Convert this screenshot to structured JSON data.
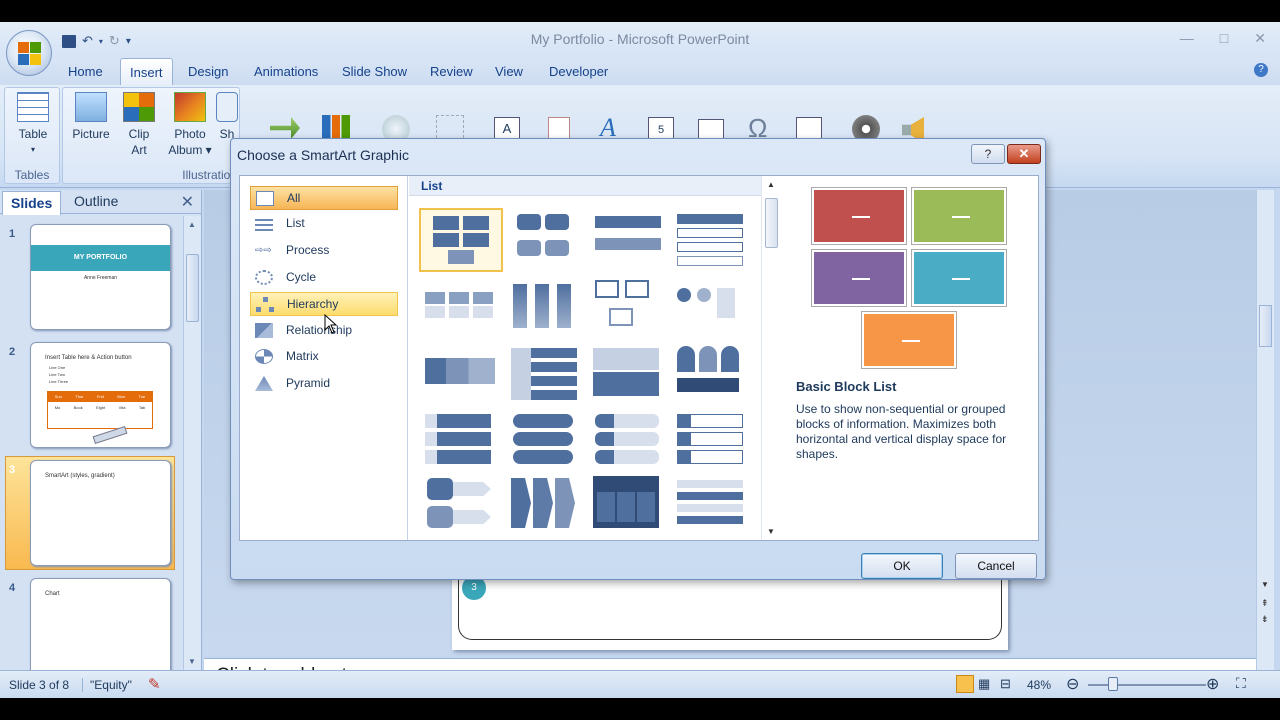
{
  "window": {
    "title": "My Portfolio - Microsoft PowerPoint",
    "controls": [
      "—",
      "□",
      "✕"
    ]
  },
  "tabs": [
    {
      "label": "Home",
      "active": false
    },
    {
      "label": "Insert",
      "active": true
    },
    {
      "label": "Design",
      "active": false
    },
    {
      "label": "Animations",
      "active": false
    },
    {
      "label": "Slide Show",
      "active": false
    },
    {
      "label": "Review",
      "active": false
    },
    {
      "label": "View",
      "active": false
    },
    {
      "label": "Developer",
      "active": false
    }
  ],
  "ribbon": {
    "groups": {
      "tables": "Tables",
      "illustrations": "Illustration"
    },
    "buttons": {
      "table": "Table",
      "table_arrow": "▾",
      "picture": "Picture",
      "clip_art_1": "Clip",
      "clip_art_2": "Art",
      "photo_album_1": "Photo",
      "photo_album_2": "Album ▾",
      "shapes": "Sh"
    }
  },
  "left_pane": {
    "tab_slides": "Slides",
    "tab_outline": "Outline",
    "close": "✕",
    "slides": [
      {
        "num": "1",
        "title": "MY PORTFOLIO",
        "subtitle": "Anne Freeman"
      },
      {
        "num": "2",
        "title": "Insert Table here & Action button",
        "bullets": [
          "Line One",
          "Line Two",
          "Line Three"
        ],
        "table_headers": [
          "Sun",
          "Thur",
          "Frid",
          "Mon",
          "Tue"
        ],
        "table_row": [
          "Mo",
          "Book",
          "Eight",
          "Vita",
          "Tab"
        ]
      },
      {
        "num": "3",
        "title": "SmartArt (styles, gradient)",
        "selected": true
      },
      {
        "num": "4",
        "title": "Chart"
      }
    ]
  },
  "canvas": {
    "circle_num": "3"
  },
  "notes": {
    "placeholder": "Click to add notes"
  },
  "status": {
    "slide": "Slide 3 of 8",
    "theme": "\"Equity\"",
    "zoom": "48%"
  },
  "dialog": {
    "title": "Choose a SmartArt Graphic",
    "help": "?",
    "close": "✕",
    "categories": [
      {
        "label": "All",
        "state": "selected"
      },
      {
        "label": "List",
        "state": "normal"
      },
      {
        "label": "Process",
        "state": "normal"
      },
      {
        "label": "Cycle",
        "state": "normal"
      },
      {
        "label": "Hierarchy",
        "state": "hover"
      },
      {
        "label": "Relationship",
        "state": "normal"
      },
      {
        "label": "Matrix",
        "state": "normal"
      },
      {
        "label": "Pyramid",
        "state": "normal"
      }
    ],
    "gallery_heading": "List",
    "preview": {
      "name": "Basic Block List",
      "description": "Use to show non-sequential or grouped blocks of information. Maximizes both horizontal and vertical display space for shapes.",
      "colors": [
        "#c0504d",
        "#9bbb59",
        "#8064a2",
        "#4bacc6",
        "#f79646"
      ]
    },
    "ok": "OK",
    "cancel": "Cancel"
  },
  "colors": {
    "accent": "#15428b",
    "ribbon_bg": "#dbe7f7",
    "selection": "#f7b555",
    "gallery_shape": "#4f6f9f"
  }
}
